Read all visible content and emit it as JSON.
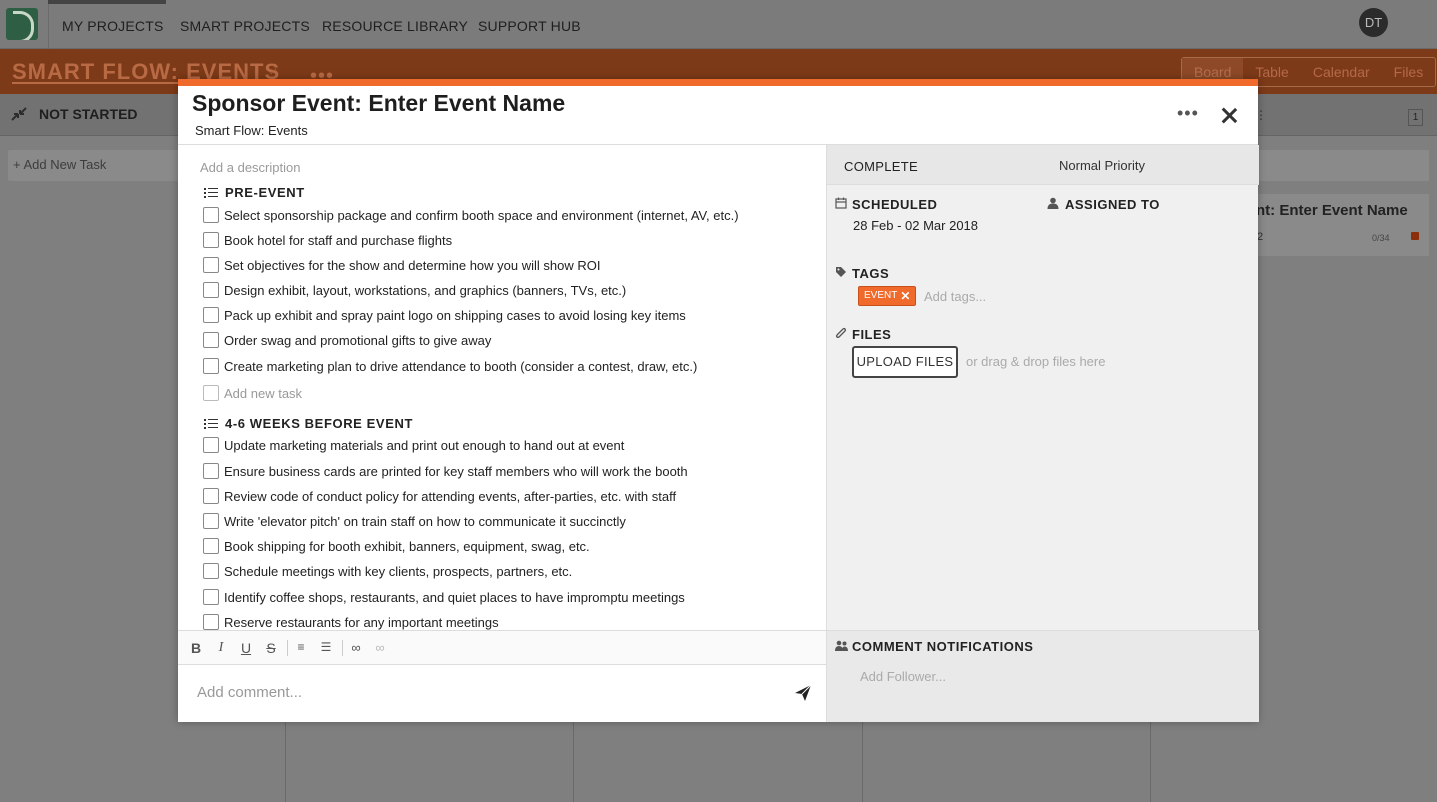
{
  "nav": {
    "items": [
      "MY PROJECTS",
      "SMART PROJECTS",
      "RESOURCE LIBRARY",
      "SUPPORT HUB"
    ],
    "avatar": "DT"
  },
  "project": {
    "title": "SMART FLOW: EVENTS",
    "views": [
      "Board",
      "Table",
      "Calendar",
      "Files"
    ],
    "active_view": "Board"
  },
  "board": {
    "column_title": "NOT STARTED",
    "add_task": "+ Add New Task",
    "right_card_title": "nt: Enter Event Name",
    "right_card_num": "2",
    "right_card_meta": "0/34",
    "column_badge": "1"
  },
  "modal": {
    "title": "Sponsor Event: Enter Event Name",
    "subtitle": "Smart Flow: Events",
    "description_placeholder": "Add a description",
    "sections": [
      {
        "title": "PRE-EVENT",
        "tasks": [
          "Select sponsorship package and confirm booth space and environment (internet, AV, etc.)",
          "Book hotel for staff and purchase flights",
          "Set objectives for the show and determine how you will show ROI",
          "Design exhibit, layout, workstations, and graphics (banners, TVs, etc.)",
          "Pack up exhibit and spray paint logo on shipping cases to avoid losing key items",
          "Order swag and promotional gifts to give away",
          "Create marketing plan to drive attendance to booth (consider a contest, draw, etc.)"
        ],
        "add_task": "Add new task"
      },
      {
        "title": "4-6 WEEKS BEFORE EVENT",
        "tasks": [
          "Update marketing materials and print out enough to hand out at event",
          "Ensure business cards are printed for key staff members who will work the booth",
          "Review code of conduct policy for attending events, after-parties, etc. with staff",
          "Write 'elevator pitch' on train staff on how to communicate it succinctly",
          "Book shipping for booth exhibit, banners, equipment, swag, etc.",
          "Schedule meetings with key clients, prospects, partners, etc.",
          "Identify coffee shops, restaurants, and quiet places to have impromptu meetings",
          "Reserve restaurants for any important meetings"
        ]
      }
    ],
    "comment_placeholder": "Add comment...",
    "status": "COMPLETE",
    "priority": "Normal Priority",
    "scheduled_label": "SCHEDULED",
    "scheduled_value": "28 Feb - 02 Mar 2018",
    "assigned_label": "ASSIGNED TO",
    "tags_label": "TAGS",
    "tag": "EVENT",
    "tags_placeholder": "Add tags...",
    "files_label": "FILES",
    "upload_label": "UPLOAD FILES",
    "drop_hint": "or drag & drop files here",
    "notifications_label": "COMMENT NOTIFICATIONS",
    "follower_placeholder": "Add Follower..."
  },
  "colors": {
    "accent": "#ef6a2b",
    "dim_header": "#7d3a18"
  }
}
